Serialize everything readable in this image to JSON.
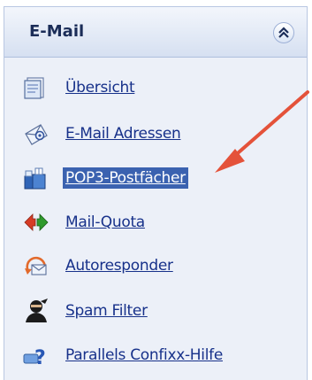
{
  "panel": {
    "title": "E-Mail"
  },
  "icons": {
    "collapse": "double-chevron-up-icon",
    "overview": "document-icon",
    "email_addresses": "envelope-icon",
    "pop3": "mailbox-icon",
    "quota": "quota-arrows-icon",
    "autoresponder": "autoresponder-icon",
    "spam": "ninja-icon",
    "help": "help-icon"
  },
  "menu": {
    "items": [
      {
        "label": "Übersicht",
        "active": false
      },
      {
        "label": "E-Mail Adressen",
        "active": false
      },
      {
        "label": "POP3-Postfächer",
        "active": true
      },
      {
        "label": "Mail-Quota",
        "active": false
      },
      {
        "label": "Autoresponder",
        "active": false
      },
      {
        "label": "Spam Filter",
        "active": false
      },
      {
        "label": "Parallels Confixx-Hilfe",
        "active": false
      }
    ]
  },
  "colors": {
    "link": "#17318a",
    "active_bg": "#3b62b0",
    "arrow": "#e4523a"
  }
}
